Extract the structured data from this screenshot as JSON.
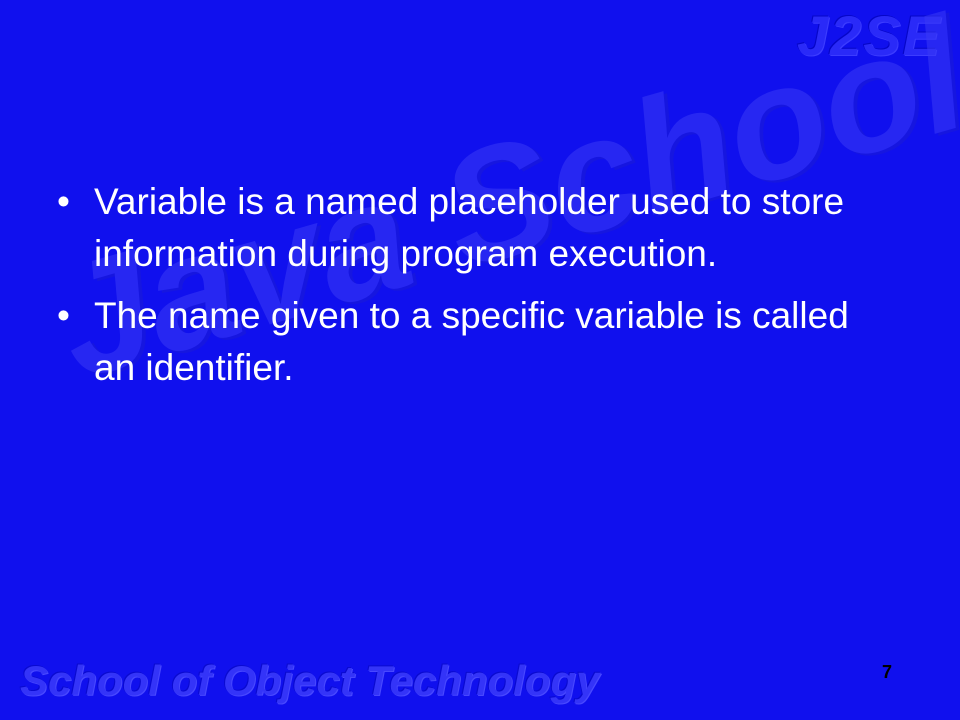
{
  "header": {
    "logo_text": "J2SE"
  },
  "watermark": {
    "text": "Java School"
  },
  "content": {
    "bullets": [
      {
        "marker": "•",
        "text": "Variable is a named placeholder used to store information during program execution."
      },
      {
        "marker": "•",
        "text": "The name given to a specific variable is called an identifier."
      }
    ]
  },
  "footer": {
    "brand_text": "School of Object Technology",
    "page_number": "7"
  },
  "colors": {
    "background": "#1010ee",
    "text": "#ffffff",
    "page_number": "#000000"
  }
}
